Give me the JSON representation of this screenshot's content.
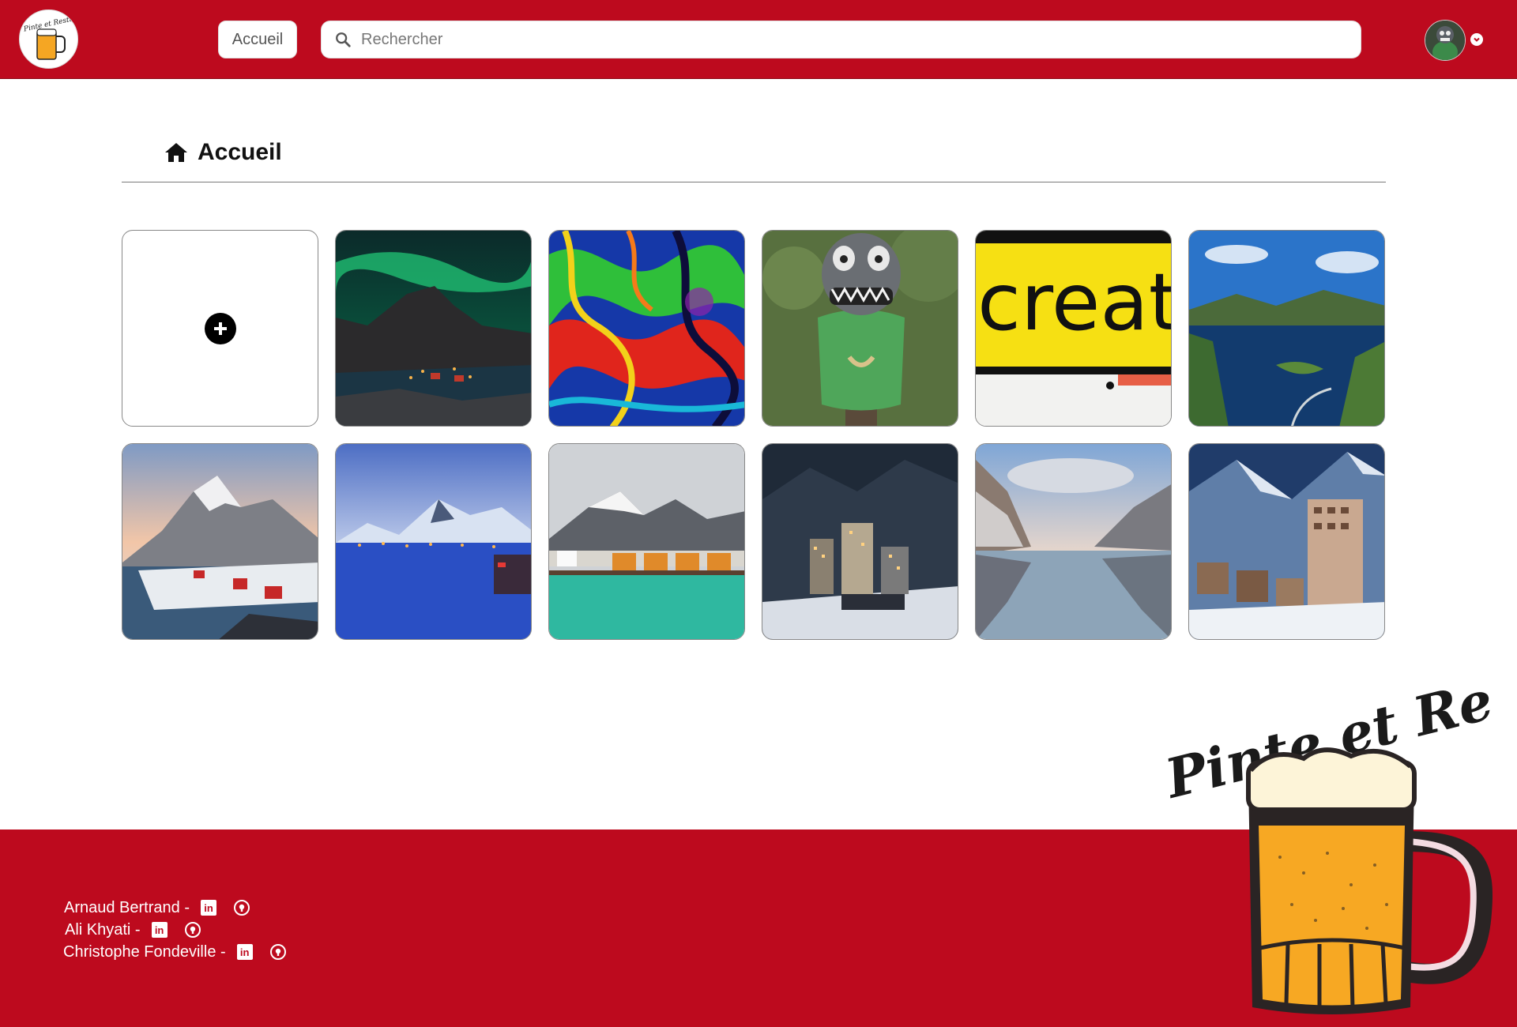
{
  "header": {
    "brand": "Pinte et Reste",
    "home_label": "Accueil",
    "search_placeholder": "Rechercher",
    "search_value": ""
  },
  "page": {
    "title": "Accueil"
  },
  "gallery": {
    "add_label": "+",
    "items": [
      {
        "theme": "aurora-lofoten"
      },
      {
        "theme": "abstract-marbling"
      },
      {
        "theme": "carved-creature"
      },
      {
        "theme": "create-sign"
      },
      {
        "theme": "reine-fjord-aerial"
      },
      {
        "theme": "hamnoy-winter"
      },
      {
        "theme": "blue-hour-harbour"
      },
      {
        "theme": "fishing-village"
      },
      {
        "theme": "ski-resort-night"
      },
      {
        "theme": "lake-reflection"
      },
      {
        "theme": "snowy-chalets"
      }
    ]
  },
  "footer": {
    "authors": [
      {
        "name": "Arnaud Bertrand -"
      },
      {
        "name": "Ali Khyati -"
      },
      {
        "name": "Christophe Fondeville -"
      }
    ],
    "linkedin_glyph": "in"
  },
  "mascot": {
    "brand_text": "Pinte et Reste"
  },
  "colors": {
    "brand_red": "#bd0a1e",
    "white": "#ffffff"
  },
  "icons": {
    "home": "home-icon",
    "search": "search-icon",
    "caret": "chevron-down-icon",
    "add": "plus-circle-icon",
    "linkedin": "linkedin-icon",
    "github": "github-icon"
  }
}
